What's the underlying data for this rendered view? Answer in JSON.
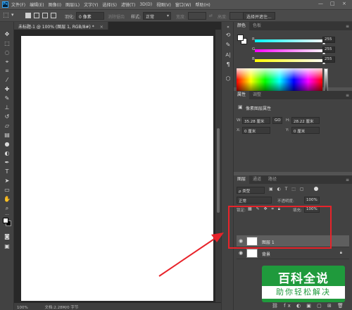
{
  "menubar": {
    "logo": "Ps",
    "items": [
      "文件(F)",
      "编辑(E)",
      "图像(I)",
      "图层(L)",
      "文字(Y)",
      "选择(S)",
      "滤镜(T)",
      "3D(D)",
      "视图(V)",
      "窗口(W)",
      "帮助(H)"
    ],
    "window_controls": [
      "—",
      "□",
      "×"
    ]
  },
  "options_bar": {
    "feather_label": "羽化:",
    "feather_value": "0 像素",
    "antialias_label": "消除锯齿",
    "style_label": "样式:",
    "style_value": "正常",
    "width_label": "宽度:",
    "height_label": "高度:",
    "select_mask_button": "选择并遮住..."
  },
  "document": {
    "tab_title": "未标题-1 @ 100% (图层 1, RGB/8#) *",
    "tab_close": "×",
    "status_zoom": "100%",
    "status_doc": "文档:2.28M/0 字节"
  },
  "color_panel": {
    "tabs": [
      "颜色",
      "色板"
    ],
    "slider_r": {
      "label": "R",
      "value": "255"
    },
    "slider_g": {
      "label": "G",
      "value": "255"
    },
    "slider_b": {
      "label": "B",
      "value": "255"
    }
  },
  "properties_panel": {
    "tabs": [
      "属性",
      "调整"
    ],
    "pixel_layer_title": "像素图层属性",
    "w_label": "W:",
    "w_value": "35.28 厘米",
    "link": "GO",
    "h_label": "H:",
    "h_value": "28.22 厘米",
    "x_label": "X:",
    "x_value": "0 厘米",
    "y_label": "Y:",
    "y_value": "0 厘米"
  },
  "layers_panel": {
    "tabs": [
      "图层",
      "通道",
      "路径"
    ],
    "filter_kind": "ρ 类型",
    "blend_mode": "正常",
    "opacity_label": "不透明度:",
    "opacity_value": "100%",
    "lock_label": "锁定:",
    "fill_label": "填充:",
    "fill_value": "100%",
    "layers": [
      {
        "name": "图层 1",
        "selected": true
      },
      {
        "name": "背景",
        "selected": false
      }
    ]
  },
  "watermark": {
    "line1": "百科全说",
    "line2": "助你轻松解决"
  },
  "colors": {
    "annotation_red": "#e8232a",
    "watermark_green": "#1f9a3c"
  }
}
